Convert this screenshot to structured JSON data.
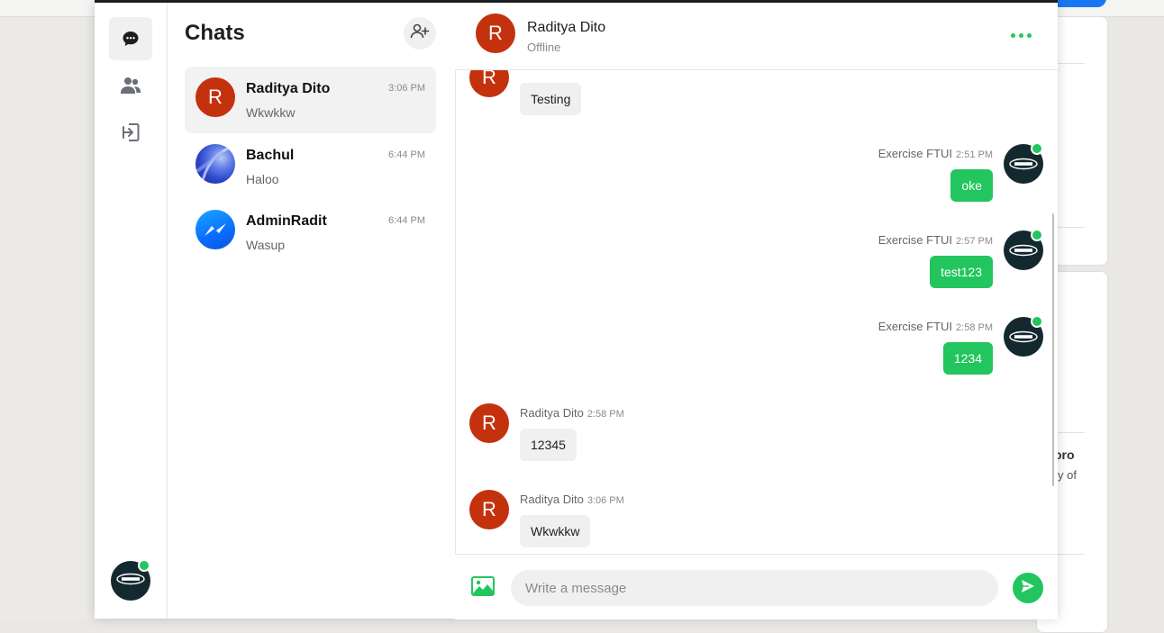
{
  "background": {
    "partial_text_1": "oro",
    "partial_text_2": "y of"
  },
  "rail": {
    "items": [
      {
        "name": "chats",
        "icon": "chat-bubble-icon",
        "active": true
      },
      {
        "name": "friends",
        "icon": "users-icon",
        "active": false
      },
      {
        "name": "logout",
        "icon": "logout-icon",
        "active": false
      }
    ],
    "user_avatar": "racing-logo-avatar"
  },
  "chat_list": {
    "title": "Chats",
    "add_icon": "add-user-icon",
    "items": [
      {
        "name": "Raditya Dito",
        "last_message": "Wkwkkw",
        "time": "3:06 PM",
        "avatar_letter": "R",
        "active": true
      },
      {
        "name": "Bachul",
        "last_message": "Haloo",
        "time": "6:44 PM",
        "avatar_letter": "",
        "active": false
      },
      {
        "name": "AdminRadit",
        "last_message": "Wasup",
        "time": "6:44 PM",
        "avatar_letter": "",
        "active": false
      }
    ]
  },
  "conversation": {
    "header": {
      "avatar_letter": "R",
      "name": "Raditya Dito",
      "status": "Offline",
      "more_icon": "more-horizontal-icon"
    },
    "messages": [
      {
        "sender": "Raditya Dito",
        "time": "",
        "text": "Testing",
        "outgoing": false
      },
      {
        "sender": "Exercise FTUI",
        "time": "2:51 PM",
        "text": "oke",
        "outgoing": true
      },
      {
        "sender": "Exercise FTUI",
        "time": "2:57 PM",
        "text": "test123",
        "outgoing": true
      },
      {
        "sender": "Exercise FTUI",
        "time": "2:58 PM",
        "text": "1234",
        "outgoing": true
      },
      {
        "sender": "Raditya Dito",
        "time": "2:58 PM",
        "text": "12345",
        "outgoing": false
      },
      {
        "sender": "Raditya Dito",
        "time": "3:06 PM",
        "text": "Wkwkkw",
        "outgoing": false
      }
    ],
    "avatar_letter": "R",
    "composer": {
      "placeholder": "Write a message",
      "image_icon": "image-icon",
      "send_icon": "send-icon"
    }
  },
  "colors": {
    "accent": "#23c55e",
    "avatar_red": "#c4320d",
    "brand_blue": "#1877f2"
  }
}
